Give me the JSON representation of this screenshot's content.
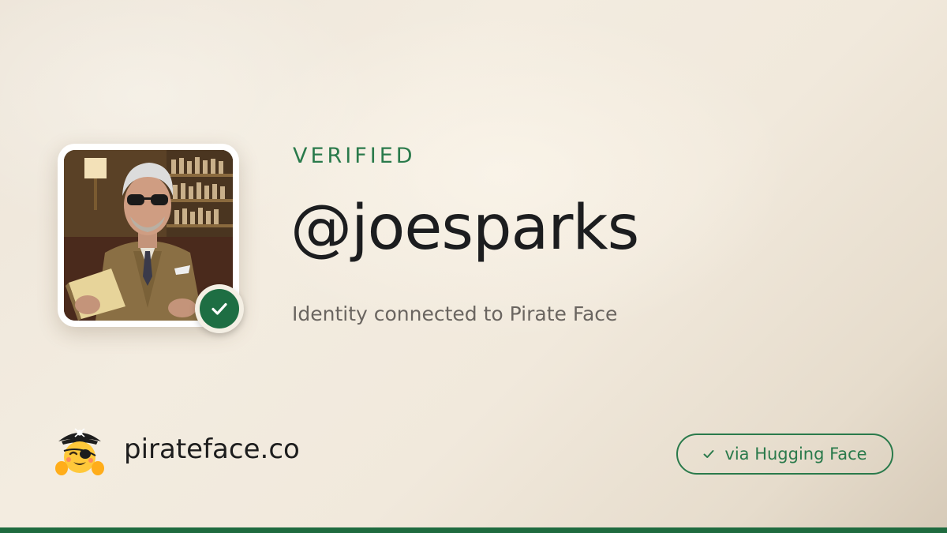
{
  "card": {
    "status": "VERIFIED",
    "username": "@joesparks",
    "subtitle": "Identity connected to Pirate Face"
  },
  "avatar": {
    "badge_icon": "check-icon",
    "badge_color": "#1e6e43"
  },
  "footer": {
    "brand_logo_icon": "pirate-hugging-face-icon",
    "brand_name": "pirateface.co",
    "via_icon": "check-icon",
    "via_label": "via Hugging Face"
  },
  "colors": {
    "accent_green": "#2a7a4b",
    "bottom_bar": "#1f6b3f",
    "text_dark": "#1c1d1f",
    "text_muted": "#6a6560"
  }
}
